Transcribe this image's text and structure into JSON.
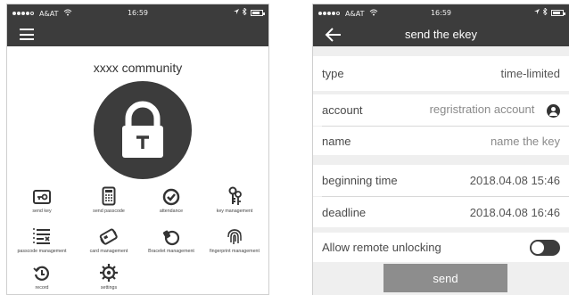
{
  "left_screen": {
    "status": {
      "carrier": "A&AT",
      "time": "16:59"
    },
    "community_title": "xxxx community",
    "grid": [
      {
        "label": "send key",
        "icon": "key-card-icon"
      },
      {
        "label": "send passcode",
        "icon": "keypad-icon"
      },
      {
        "label": "attendance",
        "icon": "check-circle-icon"
      },
      {
        "label": "key management",
        "icon": "keys-icon"
      },
      {
        "label": "passcode management",
        "icon": "list-icon"
      },
      {
        "label": "card management",
        "icon": "card-icon"
      },
      {
        "label": "Bracelet management",
        "icon": "bracelet-icon"
      },
      {
        "label": "fingerprint management",
        "icon": "fingerprint-icon"
      },
      {
        "label": "record",
        "icon": "history-icon"
      },
      {
        "label": "settings",
        "icon": "gear-icon"
      }
    ]
  },
  "right_screen": {
    "status": {
      "carrier": "A&AT",
      "time": "16:59"
    },
    "title": "send the ekey",
    "type_label": "type",
    "type_value": "time-limited",
    "account_label": "account",
    "account_placeholder": "regristration account",
    "name_label": "name",
    "name_placeholder": "name the key",
    "begin_label": "beginning time",
    "begin_value": "2018.04.08 15:46",
    "deadline_label": "deadline",
    "deadline_value": "2018.04.08 16:46",
    "remote_label": "Allow remote unlocking",
    "remote_enabled": false,
    "send_label": "send"
  },
  "colors": {
    "dark": "#3c3c3c",
    "button": "#8d8d8d",
    "background": "#efefef"
  }
}
